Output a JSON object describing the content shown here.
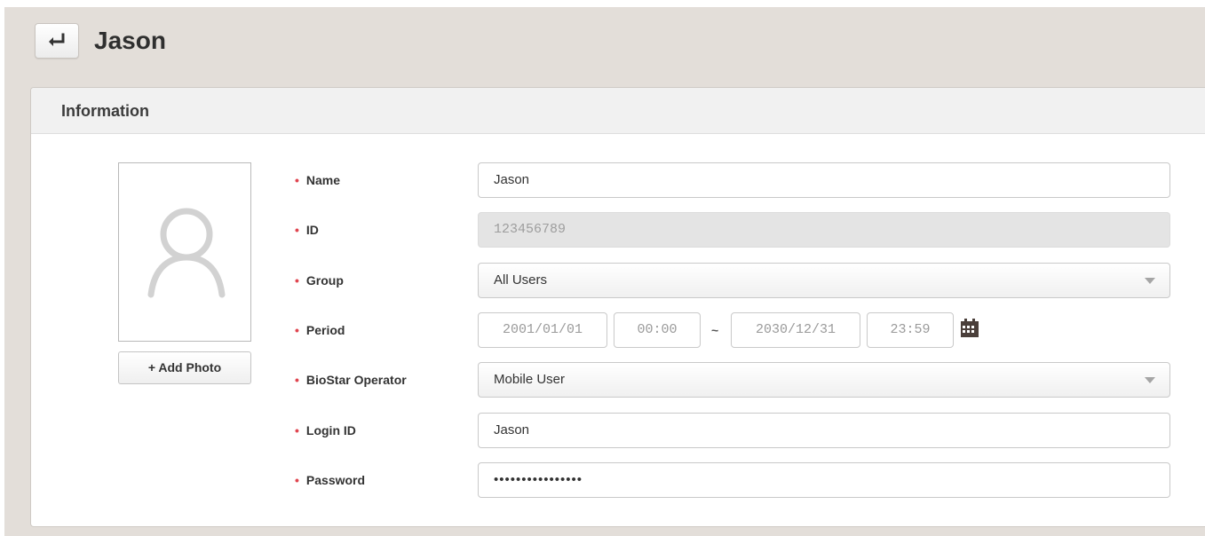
{
  "header": {
    "title": "Jason",
    "back_icon": "return-arrow-icon"
  },
  "panel": {
    "title": "Information"
  },
  "photo": {
    "placeholder_icon": "user-silhouette-icon",
    "add_label": "+ Add Photo"
  },
  "form": {
    "name": {
      "label": "Name",
      "value": "Jason"
    },
    "id": {
      "label": "ID",
      "value": "123456789"
    },
    "group": {
      "label": "Group",
      "value": "All Users"
    },
    "period": {
      "label": "Period",
      "start_date": "2001/01/01",
      "start_time": "00:00",
      "separator": "~",
      "end_date": "2030/12/31",
      "end_time": "23:59",
      "calendar_icon": "calendar-icon"
    },
    "operator": {
      "label": "BioStar Operator",
      "value": "Mobile User"
    },
    "login_id": {
      "label": "Login ID",
      "value": "Jason"
    },
    "password": {
      "label": "Password",
      "value": "••••••••••••••••"
    }
  },
  "colors": {
    "background": "#e3ded9",
    "required_marker": "#e0454f",
    "disabled_field": "#e4e4e4"
  }
}
